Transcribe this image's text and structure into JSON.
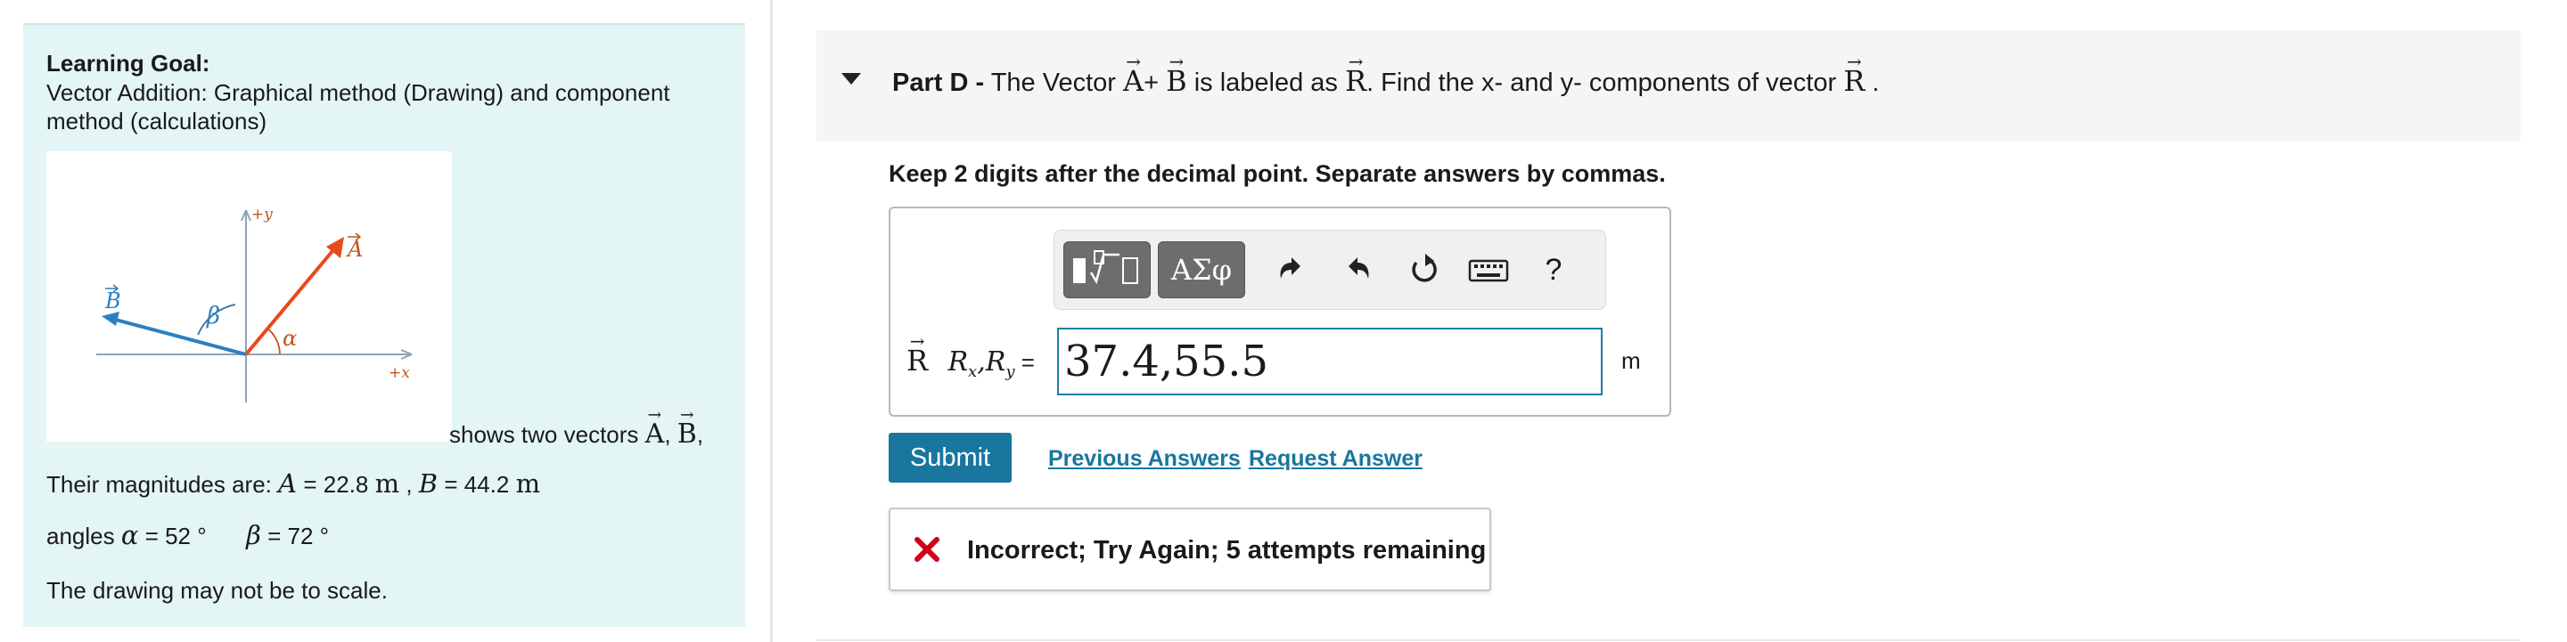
{
  "learning_goal": {
    "title": "Learning Goal:",
    "text": "Vector Addition: Graphical method (Drawing)  and component method (calculations)"
  },
  "figure": {
    "axis_x_label": "+x",
    "axis_y_label": "+y",
    "vector_a_label": "A",
    "vector_b_label": "B",
    "angle_alpha_label": "α",
    "angle_beta_label": "β",
    "vector_a_color": "#e8491d",
    "vector_b_color": "#2a7fc0"
  },
  "description": {
    "shows_prefix": "shows two vectors",
    "vec_a": "A",
    "sep": ",",
    "vec_b": "B",
    "trail": ",",
    "magnitudes_prefix": "Their magnitudes are:",
    "mag_a_symbol": "A",
    "mag_a_value": "= 22.8",
    "mag_a_unit": "m",
    "mag_sep": ",",
    "mag_b_symbol": "B",
    "mag_b_value": "= 44.2",
    "mag_b_unit": "m",
    "angles_prefix": "angles",
    "alpha_symbol": "α",
    "alpha_value": "= 52 °",
    "beta_symbol": "β",
    "beta_value": "= 72 °",
    "scale_note": "The drawing may not be to scale."
  },
  "part": {
    "label": "Part D -",
    "title_1": "The Vector",
    "vec_a": "A",
    "plus": "+",
    "vec_b": "B",
    "title_2": "is labeled as",
    "vec_r": "R",
    "title_3": ". Find the  x- and y- components of vector",
    "title_end": "."
  },
  "instructions": "Keep 2 digits after the decimal point. Separate answers by commas.",
  "answer": {
    "vec_symbol": "R",
    "label_rx": "R",
    "label_x_sub": "x",
    "label_comma": ",",
    "label_ry": "R",
    "label_y_sub": "y",
    "label_equals": " =",
    "value": "37.4,55.5",
    "unit": "m"
  },
  "toolbar": {
    "symbols_label": "ΑΣφ",
    "help_label": "?"
  },
  "actions": {
    "submit_label": "Submit",
    "previous_answers_label": "Previous Answers",
    "request_answer_label": "Request Answer"
  },
  "feedback": {
    "message": "Incorrect; Try Again; 5 attempts remaining",
    "color": "#d0021b"
  }
}
